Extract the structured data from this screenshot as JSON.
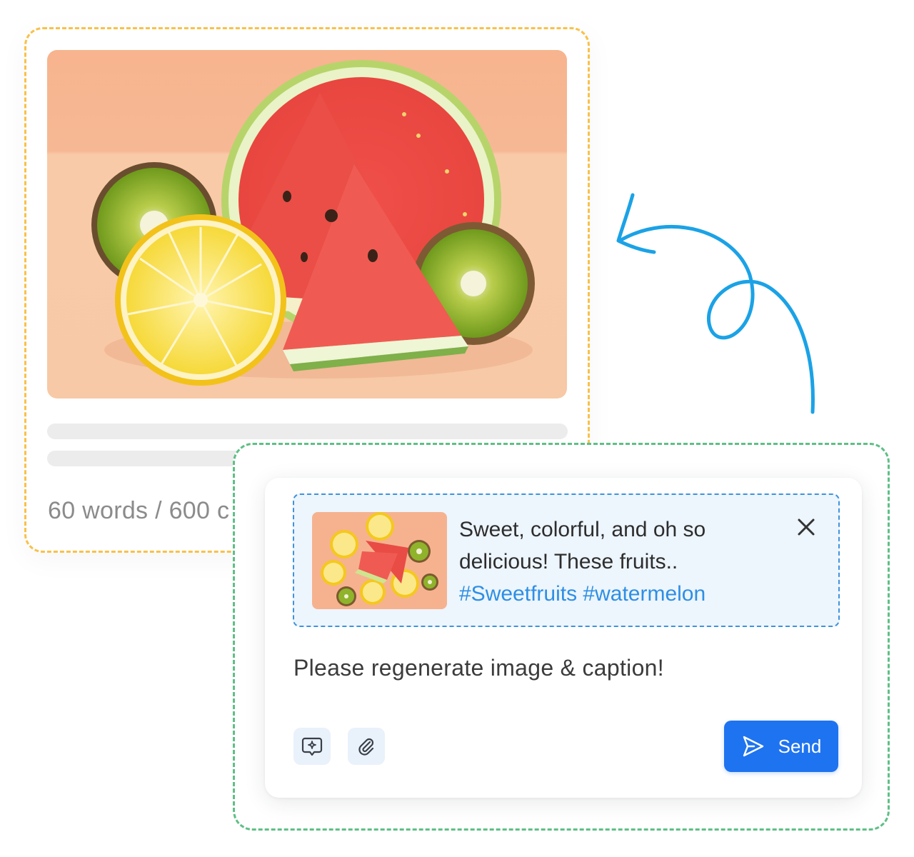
{
  "post_card": {
    "image_alt": "watermelon-kiwi-lemon-photo",
    "word_count": "60 words / 600 c"
  },
  "chat": {
    "preview": {
      "caption_line1": "Sweet, colorful, and oh so",
      "caption_line2": "delicious!  These fruits..",
      "hashtags": "#Sweetfruits #watermelon"
    },
    "message": "Please regenerate image & caption!",
    "send_label": "Send"
  },
  "icons": {
    "close": "close-icon",
    "ai_chat": "sparkle-chat-icon",
    "attach": "paperclip-icon",
    "send": "send-icon"
  },
  "colors": {
    "post_border": "#f8c14a",
    "chat_border": "#5fbf86",
    "preview_border": "#3f93dd",
    "hashtag": "#2e8fe3",
    "send_button": "#1e73f0",
    "arrow": "#1ba2e6"
  }
}
